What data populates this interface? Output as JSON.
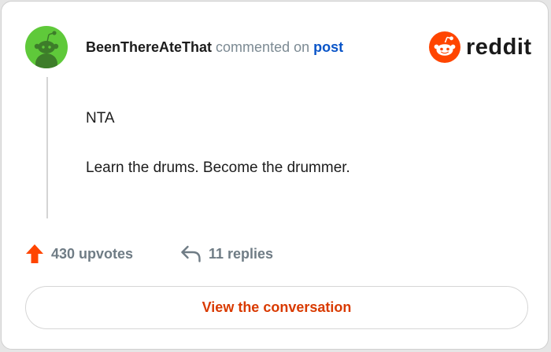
{
  "comment": {
    "author": "BeenThereAteThat",
    "action_text": "commented on",
    "post_link_text": "post",
    "body_lines": [
      "NTA",
      "Learn the drums. Become the drummer."
    ]
  },
  "brand": {
    "icon": "reddit-snoo-icon",
    "wordmark": "reddit",
    "accent_color": "#ff4500"
  },
  "avatar": {
    "icon": "snoo-avatar-icon",
    "background_color": "#5fc93a"
  },
  "stats": {
    "upvotes_label": "430 upvotes",
    "upvote_icon": "upvote-arrow-icon",
    "upvote_color": "#ff4500",
    "replies_label": "11 replies",
    "reply_icon": "reply-arrow-icon"
  },
  "actions": {
    "view_conversation_label": "View the conversation",
    "button_text_color": "#d93a00"
  }
}
